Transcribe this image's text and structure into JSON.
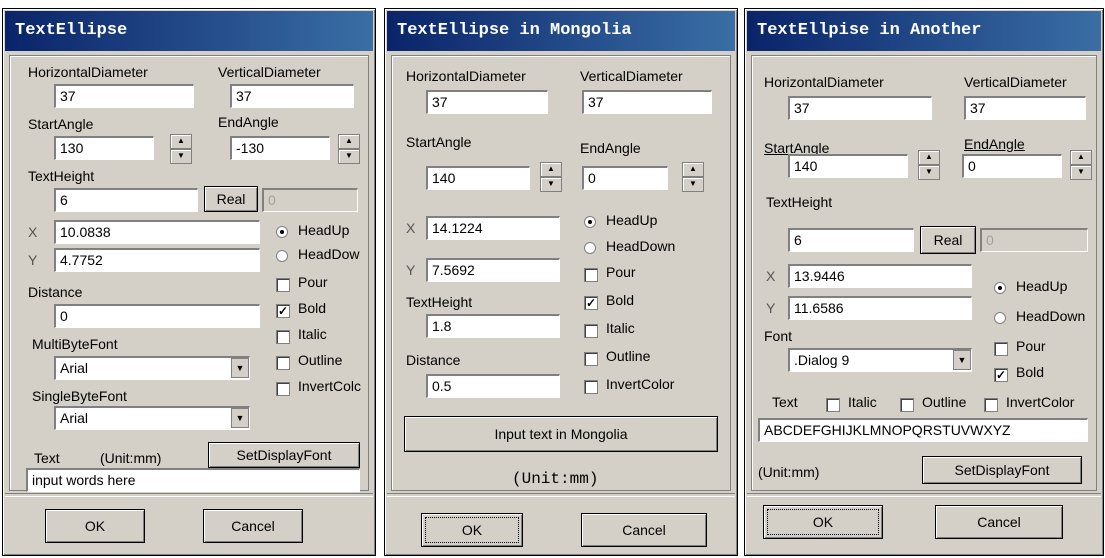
{
  "d1": {
    "title": "TextEllipse",
    "h_label": "HorizontalDiameter",
    "h_value": "37",
    "v_label": "VerticalDiameter",
    "v_value": "37",
    "start_label": "StartAngle",
    "start_value": "130",
    "end_label": "EndAngle",
    "end_value": "-130",
    "th_label": "TextHeight",
    "th_value": "6",
    "real_label": "Real",
    "real_value": "0",
    "x_label": "X",
    "x_value": "10.0838",
    "y_label": "Y",
    "y_value": "4.7752",
    "headup": "HeadUp",
    "headdown": "HeadDow",
    "pour": "Pour",
    "bold": "Bold",
    "italic": "Italic",
    "outline": "Outline",
    "invert": "InvertColc",
    "dist_label": "Distance",
    "dist_value": "0",
    "mb_label": "MultiByteFont",
    "mb_value": "Arial",
    "sb_label": "SingleByteFont",
    "sb_value": "Arial",
    "text_label": "Text",
    "unit": "(Unit:mm)",
    "setfont": "SetDisplayFont",
    "text_value": "input words here",
    "ok": "OK",
    "cancel": "Cancel"
  },
  "d2": {
    "title": "TextEllipse in Mongolia",
    "h_label": "HorizontalDiameter",
    "h_value": "37",
    "v_label": "VerticalDiameter",
    "v_value": "37",
    "start_label": "StartAngle",
    "start_value": "140",
    "end_label": "EndAngle",
    "end_value": "0",
    "x_label": "X",
    "x_value": "14.1224",
    "y_label": "Y",
    "y_value": "7.5692",
    "headup": "HeadUp",
    "headdown": "HeadDown",
    "pour": "Pour",
    "bold": "Bold",
    "italic": "Italic",
    "outline": "Outline",
    "invert": "InvertColor",
    "th_label": "TextHeight",
    "th_value": "1.8",
    "dist_label": "Distance",
    "dist_value": "0.5",
    "input_btn": "Input text in Mongolia",
    "unit": "(Unit:mm)",
    "ok": "OK",
    "cancel": "Cancel"
  },
  "d3": {
    "title": "TextEllpise in Another",
    "h_label": "HorizontalDiameter",
    "h_value": "37",
    "v_label": "VerticalDiameter",
    "v_value": "37",
    "start_label": "StartAngle",
    "start_value": "140",
    "end_label": "EndAngle",
    "end_value": "0",
    "th_label": "TextHeight",
    "th_value": "6",
    "real_label": "Real",
    "real_value": "0",
    "x_label": "X",
    "x_value": "13.9446",
    "y_label": "Y",
    "y_value": "11.6586",
    "headup": "HeadUp",
    "headdown": "HeadDown",
    "font_label": "Font",
    "font_value": ".Dialog 9",
    "pour": "Pour",
    "bold": "Bold",
    "text_label": "Text",
    "italic": "Italic",
    "outline": "Outline",
    "invert": "InvertColor",
    "text_value": "ABCDEFGHIJKLMNOPQRSTUVWXYZ",
    "unit": "(Unit:mm)",
    "setfont": "SetDisplayFont",
    "ok": "OK",
    "cancel": "Cancel"
  }
}
